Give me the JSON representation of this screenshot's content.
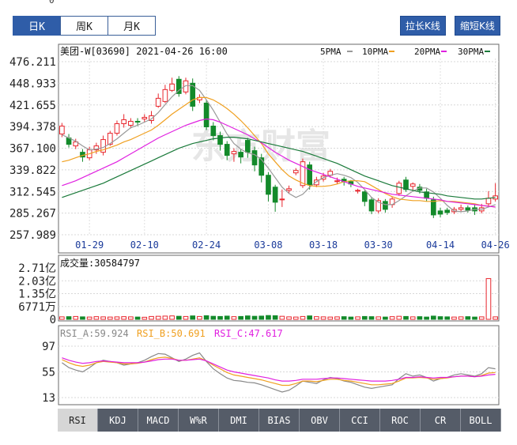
{
  "tabs": [
    {
      "label": "日K",
      "active": true
    },
    {
      "label": "周K",
      "active": false
    },
    {
      "label": "月K",
      "active": false
    }
  ],
  "zoom": {
    "zoom_out_label": "拉长K线",
    "zoom_in_label": "缩短K线"
  },
  "top_axis_label": "0",
  "watermark": "东方财富",
  "indicator_tabs": [
    "RSI",
    "KDJ",
    "MACD",
    "W%R",
    "DMI",
    "BIAS",
    "OBV",
    "CCI",
    "ROC",
    "CR",
    "BOLL"
  ],
  "active_indicator": "RSI",
  "colors": {
    "up": "#e8262d",
    "down": "#138a2a",
    "ma5": "#999999",
    "ma10": "#f0a020",
    "ma20": "#e020e0",
    "ma30": "#1a7a3a",
    "rsi_a": "#888888",
    "rsi_b": "#f0a020",
    "rsi_c": "#e020e0"
  },
  "chart_data": [
    {
      "type": "candlestick",
      "title": "美团-W[03690] 2021-04-26 16:00",
      "legend": [
        "5PMA",
        "10PMA",
        "20PMA",
        "30PMA"
      ],
      "yticks": [
        "476.211",
        "448.933",
        "421.655",
        "394.378",
        "367.100",
        "339.822",
        "312.545",
        "285.267",
        "257.989"
      ],
      "ylim": [
        257.989,
        476.211
      ],
      "xticks": [
        {
          "label": "01-29",
          "index": 4
        },
        {
          "label": "02-10",
          "index": 12
        },
        {
          "label": "02-24",
          "index": 21
        },
        {
          "label": "03-08",
          "index": 30
        },
        {
          "label": "03-18",
          "index": 38
        },
        {
          "label": "03-30",
          "index": 46
        },
        {
          "label": "04-14",
          "index": 55
        },
        {
          "label": "04-26",
          "index": 63
        }
      ],
      "candles": [
        [
          385,
          395,
          399,
          381
        ],
        [
          380,
          372,
          385,
          368
        ],
        [
          370,
          375,
          379,
          366
        ],
        [
          362,
          356,
          366,
          350
        ],
        [
          355,
          365,
          369,
          352
        ],
        [
          365,
          370,
          374,
          360
        ],
        [
          362,
          378,
          383,
          358
        ],
        [
          372,
          386,
          389,
          370
        ],
        [
          386,
          398,
          402,
          383
        ],
        [
          398,
          403,
          410,
          393
        ],
        [
          396,
          401,
          405,
          392
        ],
        [
          401,
          400,
          405,
          395
        ],
        [
          404,
          406,
          410,
          400
        ],
        [
          402,
          408,
          414,
          398
        ],
        [
          420,
          430,
          436,
          418
        ],
        [
          426,
          441,
          447,
          424
        ],
        [
          440,
          448,
          456,
          438
        ],
        [
          454,
          436,
          458,
          432
        ],
        [
          438,
          452,
          456,
          435
        ],
        [
          449,
          420,
          455,
          414
        ],
        [
          428,
          431,
          435,
          424
        ],
        [
          424,
          394,
          428,
          390
        ],
        [
          395,
          383,
          400,
          377
        ],
        [
          383,
          372,
          388,
          364
        ],
        [
          372,
          358,
          376,
          352
        ],
        [
          360,
          363,
          367,
          350
        ],
        [
          362,
          356,
          366,
          348
        ],
        [
          377,
          362,
          380,
          355
        ],
        [
          364,
          346,
          369,
          338
        ],
        [
          355,
          333,
          360,
          324
        ],
        [
          333,
          309,
          337,
          300
        ],
        [
          318,
          299,
          321,
          287
        ],
        [
          303,
          303,
          315,
          293
        ],
        [
          314,
          316,
          320,
          310
        ],
        [
          336,
          339,
          342,
          333
        ],
        [
          320,
          350,
          354,
          317
        ],
        [
          346,
          321,
          350,
          315
        ],
        [
          321,
          327,
          331,
          318
        ],
        [
          328,
          332,
          336,
          325
        ],
        [
          333,
          338,
          341,
          330
        ],
        [
          326,
          326,
          330,
          322
        ],
        [
          328,
          325,
          331,
          320
        ],
        [
          325,
          322,
          327,
          318
        ],
        [
          313,
          314,
          316,
          310
        ],
        [
          312,
          300,
          314,
          294
        ],
        [
          302,
          288,
          305,
          284
        ],
        [
          288,
          301,
          304,
          285
        ],
        [
          300,
          290,
          303,
          286
        ],
        [
          296,
          303,
          306,
          292
        ],
        [
          310,
          323,
          326,
          307
        ],
        [
          327,
          315,
          331,
          312
        ],
        [
          319,
          322,
          324,
          314
        ],
        [
          318,
          314,
          322,
          310
        ],
        [
          312,
          304,
          316,
          300
        ],
        [
          302,
          283,
          306,
          279
        ],
        [
          288,
          284,
          292,
          280
        ],
        [
          289,
          286,
          292,
          283
        ],
        [
          287,
          290,
          293,
          284
        ],
        [
          290,
          292,
          296,
          287
        ],
        [
          292,
          289,
          295,
          286
        ],
        [
          292,
          288,
          296,
          283
        ],
        [
          288,
          292,
          297,
          285
        ],
        [
          297,
          304,
          313,
          293
        ],
        [
          303,
          307,
          323,
          300
        ]
      ],
      "ma": {
        "ma5": [
          384,
          380,
          376,
          370,
          365,
          366,
          368,
          373,
          379,
          386,
          393,
          396,
          400,
          404,
          412,
          422,
          432,
          440,
          446,
          446,
          440,
          428,
          415,
          400,
          385,
          373,
          366,
          361,
          359,
          353,
          342,
          330,
          318,
          310,
          305,
          309,
          318,
          325,
          330,
          333,
          335,
          333,
          330,
          324,
          315,
          305,
          299,
          296,
          296,
          301,
          307,
          313,
          317,
          317,
          312,
          304,
          295,
          288,
          287,
          288,
          290,
          290,
          293,
          296
        ],
        "ma10": [
          350,
          352,
          355,
          358,
          360,
          363,
          365,
          368,
          371,
          375,
          378,
          382,
          386,
          390,
          396,
          403,
          410,
          416,
          422,
          428,
          431,
          431,
          428,
          423,
          417,
          410,
          402,
          393,
          383,
          373,
          360,
          350,
          340,
          332,
          327,
          323,
          320,
          319,
          319,
          320,
          322,
          325,
          326,
          326,
          325,
          320,
          315,
          310,
          306,
          303,
          302,
          301,
          301,
          300,
          300,
          301,
          300,
          300,
          299,
          298,
          297,
          295,
          294,
          293
        ],
        "ma20": [
          320,
          323,
          326,
          330,
          334,
          338,
          342,
          346,
          350,
          355,
          360,
          365,
          370,
          375,
          380,
          384,
          388,
          392,
          396,
          399,
          402,
          404,
          403,
          400,
          396,
          392,
          388,
          384,
          379,
          374,
          368,
          362,
          357,
          352,
          348,
          344,
          340,
          337,
          334,
          331,
          328,
          325,
          322,
          319,
          317,
          315,
          313,
          311,
          309,
          308,
          307,
          306,
          305,
          304,
          303,
          302,
          300,
          299,
          298,
          297,
          296,
          295,
          294,
          293
        ],
        "ma30": [
          305,
          308,
          311,
          314,
          317,
          320,
          323,
          327,
          331,
          335,
          339,
          343,
          347,
          351,
          355,
          359,
          363,
          367,
          370,
          373,
          375,
          377,
          379,
          380,
          381,
          381,
          380,
          379,
          377,
          375,
          373,
          371,
          369,
          367,
          365,
          363,
          360,
          357,
          354,
          351,
          348,
          344,
          340,
          336,
          332,
          329,
          326,
          323,
          320,
          318,
          316,
          314,
          312,
          311,
          310,
          309,
          307,
          306,
          305,
          304,
          303,
          303,
          304,
          305
        ]
      }
    },
    {
      "type": "bar",
      "title": "成交量:30584797",
      "yticks": [
        "2.71亿",
        "2.03亿",
        "1.35亿",
        "6771万",
        "0"
      ],
      "ylim": [
        0,
        271000000
      ],
      "volumes": [
        13,
        14,
        15,
        13,
        12,
        14,
        13,
        12,
        13,
        14,
        13,
        12,
        11,
        15,
        16,
        17,
        18,
        16,
        15,
        18,
        15,
        19,
        16,
        15,
        17,
        14,
        15,
        18,
        16,
        17,
        20,
        19,
        16,
        13,
        12,
        15,
        18,
        14,
        13,
        12,
        13,
        14,
        12,
        13,
        15,
        14,
        13,
        12,
        14,
        16,
        15,
        13,
        14,
        12,
        17,
        14,
        13,
        12,
        13,
        14,
        12,
        13,
        215,
        13
      ],
      "volume_unit": "百万"
    },
    {
      "type": "line",
      "series": [
        {
          "name": "RSI_A:59.924",
          "values": [
            70,
            62,
            58,
            55,
            62,
            70,
            74,
            72,
            70,
            66,
            68,
            70,
            74,
            80,
            85,
            84,
            78,
            72,
            76,
            82,
            86,
            72,
            60,
            52,
            45,
            41,
            40,
            38,
            37,
            34,
            30,
            26,
            22,
            25,
            32,
            40,
            38,
            36,
            42,
            46,
            44,
            40,
            38,
            34,
            30,
            28,
            30,
            32,
            34,
            44,
            52,
            48,
            50,
            46,
            40,
            44,
            46,
            50,
            52,
            50,
            48,
            52,
            62,
            60
          ]
        },
        {
          "name": "RSI_B:50.691",
          "values": [
            75,
            70,
            66,
            64,
            66,
            70,
            72,
            71,
            70,
            68,
            68,
            69,
            71,
            75,
            78,
            79,
            77,
            74,
            74,
            76,
            78,
            73,
            66,
            60,
            54,
            50,
            48,
            46,
            44,
            42,
            39,
            36,
            33,
            33,
            36,
            40,
            40,
            39,
            41,
            43,
            43,
            41,
            40,
            38,
            36,
            34,
            34,
            35,
            36,
            40,
            45,
            45,
            46,
            45,
            43,
            44,
            45,
            47,
            48,
            48,
            47,
            49,
            53,
            54
          ]
        },
        {
          "name": "RSI_C:47.617",
          "values": [
            78,
            74,
            71,
            69,
            70,
            72,
            73,
            72,
            71,
            70,
            70,
            70,
            71,
            73,
            75,
            76,
            76,
            74,
            74,
            75,
            76,
            73,
            68,
            63,
            58,
            55,
            53,
            51,
            49,
            47,
            45,
            42,
            40,
            40,
            41,
            43,
            43,
            43,
            44,
            45,
            45,
            44,
            43,
            42,
            41,
            40,
            40,
            40,
            41,
            43,
            46,
            46,
            47,
            46,
            45,
            46,
            46,
            47,
            48,
            48,
            47,
            48,
            50,
            51
          ]
        }
      ],
      "yticks": [
        "97",
        "55",
        "13"
      ],
      "ylim": [
        13,
        97
      ]
    }
  ]
}
